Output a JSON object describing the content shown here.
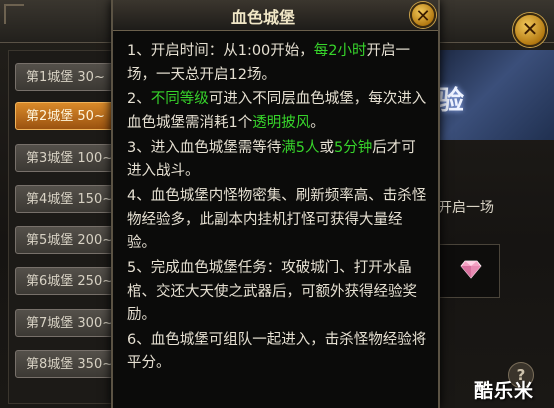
{
  "popup": {
    "title": "血色城堡",
    "close_glyph": "✕",
    "rules": [
      {
        "a": "1、开启时间：从1:00开始，",
        "g": "每2小时",
        "b": "开启一场，一天总开启12场。"
      },
      {
        "a": "2、",
        "g": "不同等级",
        "b": "可进入不同层血色城堡，每次进入血色城堡需消耗1个",
        "g2": "透明披风",
        "c": "。"
      },
      {
        "a": "3、进入血色城堡需等待",
        "g": "满5人",
        "b": "或",
        "g2": "5分钟",
        "c": "后才可进入战斗。"
      },
      {
        "a": "4、血色城堡内怪物密集、刷新频率高、击杀怪物经验多，此副本内挂机打怪可获得大量经验。"
      },
      {
        "a": "5、完成血色城堡任务：攻破城门、打开水晶棺、交还大天使之武器后，可额外获得经验奖励。"
      },
      {
        "a": "6、血色城堡可组队一起进入，击杀怪物经验将平分。"
      }
    ],
    "highlight_color": "#37d42b"
  },
  "sidebar": {
    "items": [
      {
        "label": "第1城堡 30~",
        "active": false
      },
      {
        "label": "第2城堡 50~",
        "active": true
      },
      {
        "label": "第3城堡 100~",
        "active": false
      },
      {
        "label": "第4城堡 150~",
        "active": false
      },
      {
        "label": "第5城堡 200~",
        "active": false
      },
      {
        "label": "第6城堡 250~",
        "active": false
      },
      {
        "label": "第7城堡 300~",
        "active": false
      },
      {
        "label": "第8城堡 350~",
        "active": false
      }
    ]
  },
  "background": {
    "banner_text": "验",
    "info_text": "开启一场",
    "close_glyph": "✕",
    "help_glyph": "?",
    "reward_icon": "gem-icon"
  },
  "watermark": "酷乐米"
}
